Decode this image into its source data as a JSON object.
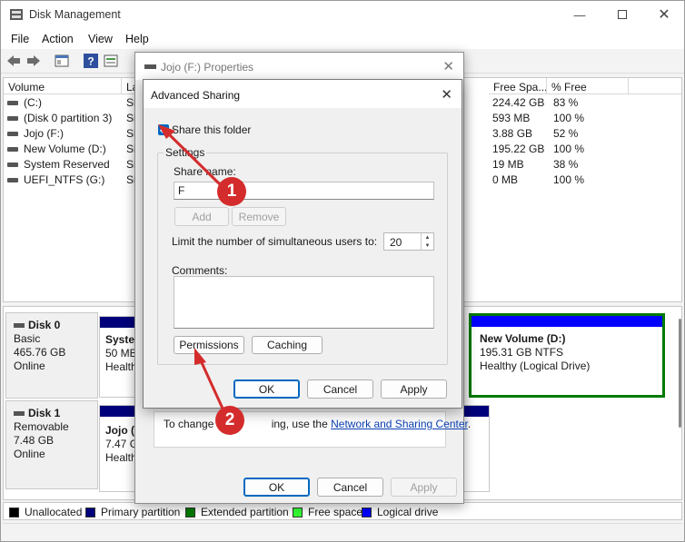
{
  "main_window": {
    "title": "Disk Management",
    "menu": [
      "File",
      "Action",
      "View",
      "Help"
    ]
  },
  "volume_list": {
    "columns": [
      "Volume",
      "La",
      "Free Spa...",
      "% Free"
    ],
    "rows": [
      {
        "volume": "(C:)",
        "layout": "Si",
        "free": "224.42 GB",
        "pct": "83 %"
      },
      {
        "volume": "(Disk 0 partition 3)",
        "layout": "Si",
        "free": "593 MB",
        "pct": "100 %"
      },
      {
        "volume": "Jojo (F:)",
        "layout": "Si",
        "free": "3.88 GB",
        "pct": "52 %"
      },
      {
        "volume": "New Volume (D:)",
        "layout": "Si",
        "free": "195.22 GB",
        "pct": "100 %"
      },
      {
        "volume": "System Reserved",
        "layout": "Si",
        "free": "19 MB",
        "pct": "38 %"
      },
      {
        "volume": "UEFI_NTFS (G:)",
        "layout": "Si",
        "free": "0 MB",
        "pct": "100 %"
      }
    ]
  },
  "disks": [
    {
      "name": "Disk 0",
      "type": "Basic",
      "size": "465.76 GB",
      "status": "Online",
      "partition_left": {
        "line1": "Syster",
        "line2": "50 MB",
        "line3": "Health"
      },
      "partition_right": {
        "line1": "New Volume  (D:)",
        "line2": "195.31 GB NTFS",
        "line3": "Healthy (Logical Drive)"
      }
    },
    {
      "name": "Disk 1",
      "type": "Removable",
      "size": "7.48 GB",
      "status": "Online",
      "partition_left": {
        "line1": "Jojo  (I",
        "line2": "7.47 GB",
        "line3": "Health"
      }
    }
  ],
  "legend": [
    {
      "label": "Unallocated",
      "color": "#000000"
    },
    {
      "label": "Primary partition",
      "color": "#00007a"
    },
    {
      "label": "Extended partition",
      "color": "#007a00"
    },
    {
      "label": "Free space",
      "color": "#33ff33"
    },
    {
      "label": "Logical drive",
      "color": "#0000ff"
    }
  ],
  "properties_dialog": {
    "title": "Jojo (F:) Properties",
    "sharing_text_before": "To change th",
    "sharing_text_mid": "ing, use the ",
    "sharing_link": "Network and Sharing Center",
    "sharing_text_after": ".",
    "ok": "OK",
    "cancel": "Cancel",
    "apply": "Apply"
  },
  "advanced_sharing": {
    "title": "Advanced Sharing",
    "share_checkbox_label": "Share this folder",
    "share_checked": true,
    "settings_legend": "Settings",
    "share_name_label": "Share name:",
    "share_name_value": "F",
    "add": "Add",
    "remove": "Remove",
    "limit_label": "Limit the number of simultaneous users to:",
    "limit_value": "20",
    "comments_label": "Comments:",
    "comments_value": "",
    "permissions": "Permissions",
    "caching": "Caching",
    "ok": "OK",
    "cancel": "Cancel",
    "apply": "Apply"
  },
  "annotations": [
    {
      "number": "1"
    },
    {
      "number": "2"
    }
  ],
  "colors": {
    "accent": "#0067c0",
    "marker": "#d42c2c",
    "primary_partition": "#00007a",
    "logical_drive": "#0000ff",
    "extended_border": "#007a00"
  }
}
